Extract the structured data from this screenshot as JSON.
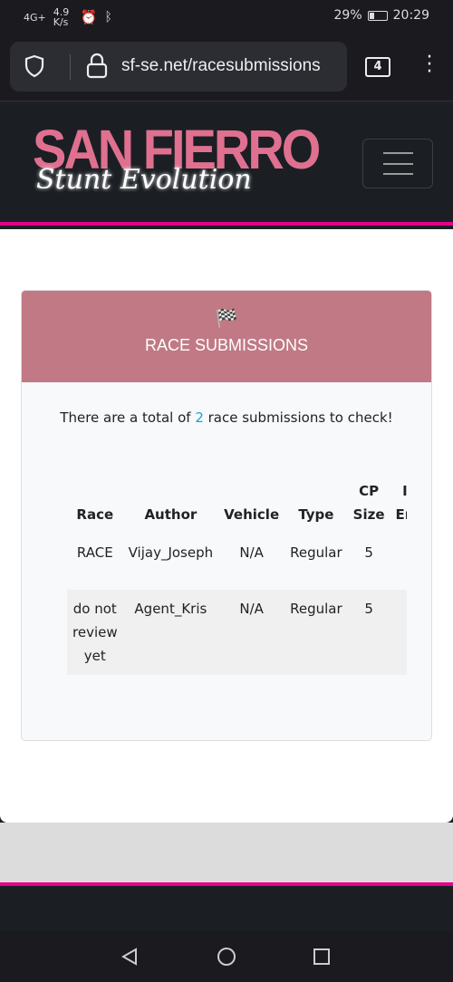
{
  "status": {
    "network": "4G+",
    "speed": "4.9 K/s",
    "battery": "29%",
    "battery_level": 0.29,
    "time": "20:29"
  },
  "browser": {
    "url": "sf-se.net/racesubmissions",
    "tab_count": "4"
  },
  "site": {
    "logo_line1": "SAN FIERRO",
    "logo_line2": "Stunt Evolution",
    "accent": "#e6008a",
    "header_color": "#c07985"
  },
  "card": {
    "title": "RACE SUBMISSIONS",
    "count_prefix": "There are a total of ",
    "count": "2",
    "count_suffix": " race submissions to check!"
  },
  "table": {
    "headers": [
      "Race",
      "Author",
      "Vehicle",
      "Type",
      "CP Size",
      "I En"
    ],
    "rows": [
      [
        "RACE",
        "Vijay_Joseph",
        "N/A",
        "Regular",
        "5",
        ""
      ],
      [
        "do not review yet",
        "Agent_Kris",
        "N/A",
        "Regular",
        "5",
        ""
      ]
    ]
  }
}
